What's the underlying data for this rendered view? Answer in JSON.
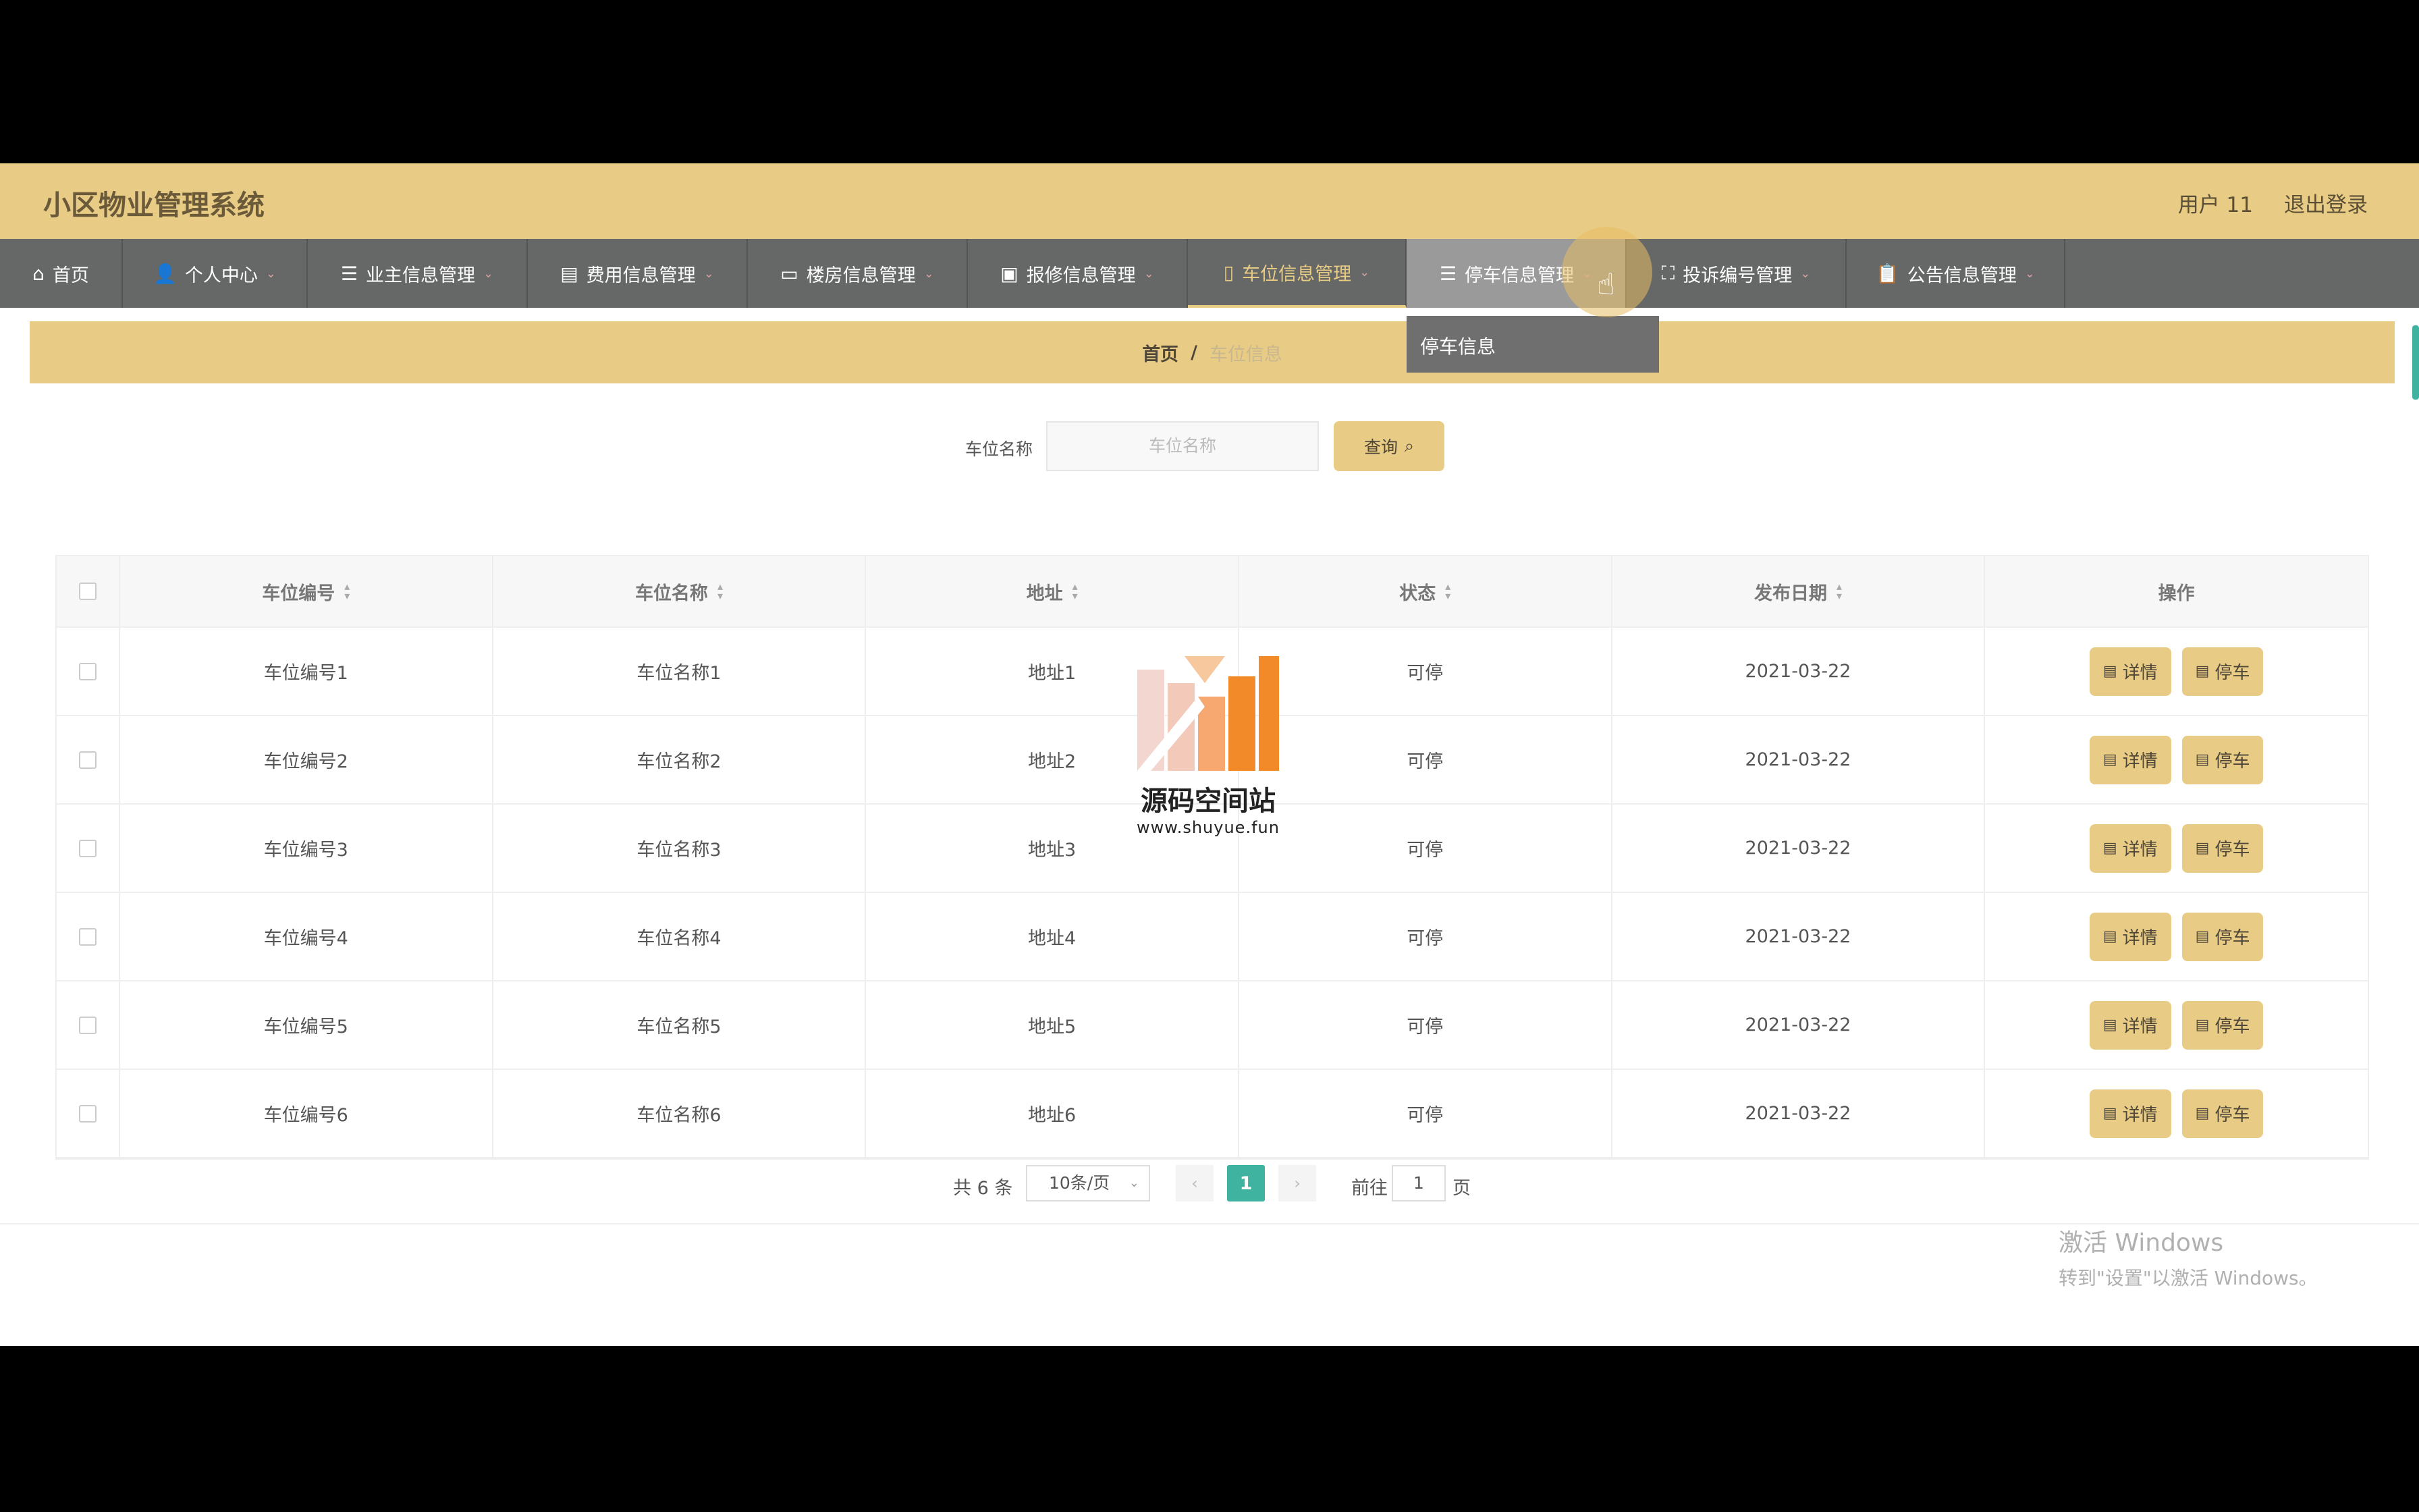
{
  "header": {
    "title": "小区物业管理系统",
    "user": "用户 11",
    "logout": "退出登录"
  },
  "nav": [
    {
      "label": "首页",
      "icon": "home-icon"
    },
    {
      "label": "个人中心",
      "icon": "user-icon"
    },
    {
      "label": "业主信息管理",
      "icon": "list-icon"
    },
    {
      "label": "费用信息管理",
      "icon": "money-icon"
    },
    {
      "label": "楼房信息管理",
      "icon": "chat-icon"
    },
    {
      "label": "报修信息管理",
      "icon": "briefcase-icon"
    },
    {
      "label": "车位信息管理",
      "icon": "mobile-icon"
    },
    {
      "label": "停车信息管理",
      "icon": "list-icon"
    },
    {
      "label": "投诉编号管理",
      "icon": "fullscreen-icon"
    },
    {
      "label": "公告信息管理",
      "icon": "clipboard-icon"
    }
  ],
  "dropdown": {
    "item": "停车信息"
  },
  "breadcrumb": {
    "home": "首页",
    "sep": "/",
    "current": "车位信息"
  },
  "search": {
    "label": "车位名称",
    "placeholder": "车位名称",
    "button": "查询"
  },
  "table": {
    "headers": [
      "车位编号",
      "车位名称",
      "地址",
      "状态",
      "发布日期",
      "操作"
    ],
    "rows": [
      {
        "code": "车位编号1",
        "name": "车位名称1",
        "addr": "地址1",
        "status": "可停",
        "date": "2021-03-22"
      },
      {
        "code": "车位编号2",
        "name": "车位名称2",
        "addr": "地址2",
        "status": "可停",
        "date": "2021-03-22"
      },
      {
        "code": "车位编号3",
        "name": "车位名称3",
        "addr": "地址3",
        "status": "可停",
        "date": "2021-03-22"
      },
      {
        "code": "车位编号4",
        "name": "车位名称4",
        "addr": "地址4",
        "status": "可停",
        "date": "2021-03-22"
      },
      {
        "code": "车位编号5",
        "name": "车位名称5",
        "addr": "地址5",
        "status": "可停",
        "date": "2021-03-22"
      },
      {
        "code": "车位编号6",
        "name": "车位名称6",
        "addr": "地址6",
        "status": "可停",
        "date": "2021-03-22"
      }
    ],
    "detail_btn": "详情",
    "park_btn": "停车"
  },
  "pagination": {
    "total": "共 6 条",
    "page_size": "10条/页",
    "current": "1",
    "goto_label": "前往",
    "goto_value": "1",
    "page_suffix": "页"
  },
  "watermark": {
    "name": "源码空间站",
    "url": "www.shuyue.fun"
  },
  "activate_windows": {
    "line1": "激活 Windows",
    "line2": "转到\"设置\"以激活 Windows。"
  },
  "colors": {
    "accent": "#e8cb84",
    "nav_bg": "#666767",
    "page_active": "#3fb3a0"
  }
}
